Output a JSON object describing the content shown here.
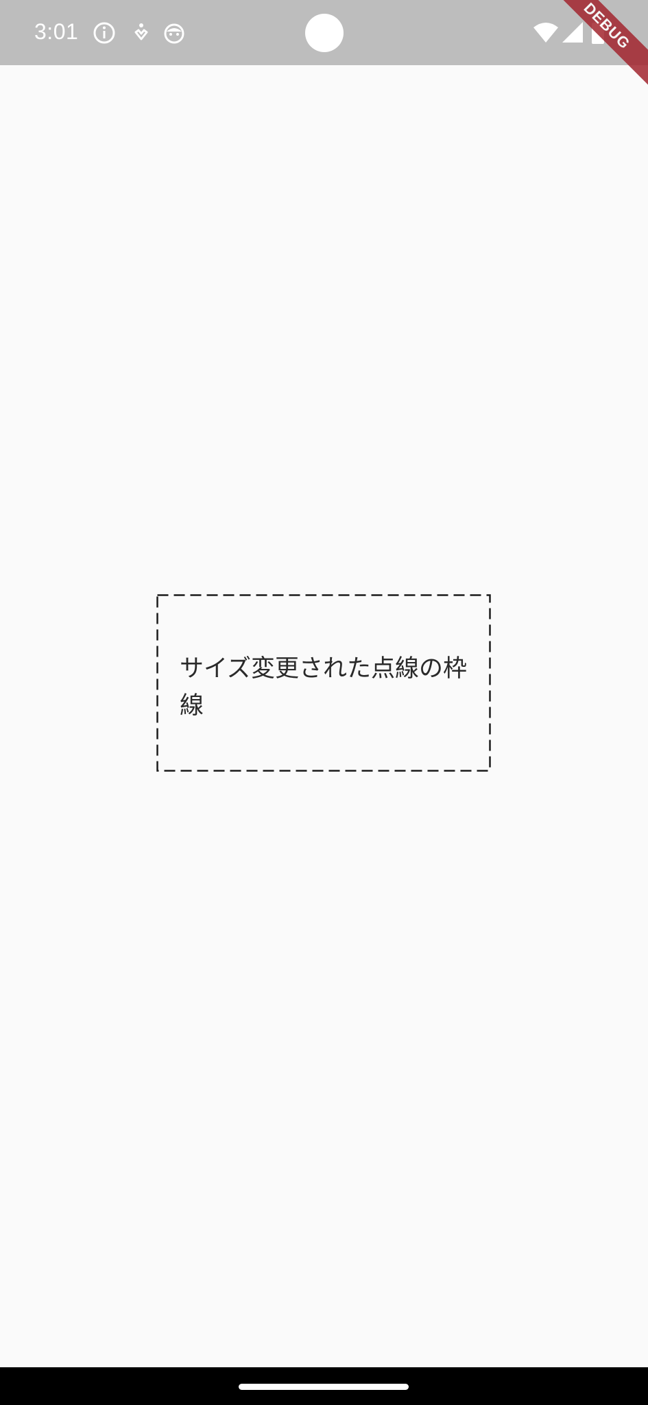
{
  "status_bar": {
    "time": "3:01",
    "left_icons": [
      "info-icon",
      "download-badge-icon",
      "robot-face-icon"
    ],
    "right_icons": [
      "wifi-icon",
      "cell-signal-icon",
      "battery-icon"
    ],
    "debug_label": "DEBUG"
  },
  "content": {
    "box_text": "サイズ変更された点線の枠線"
  },
  "colors": {
    "status_bar_bg": "#bdbdbd",
    "page_bg": "#fafafa",
    "debug_banner": "#a3262f",
    "nav_bar": "#000000"
  }
}
